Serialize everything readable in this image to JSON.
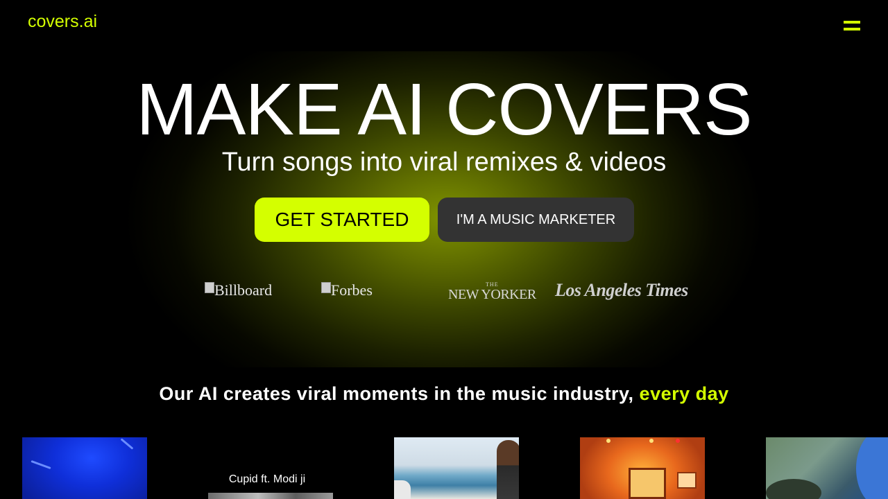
{
  "header": {
    "logo_text": "covers.ai",
    "menu_icon": "hamburger-menu-icon"
  },
  "hero": {
    "title": "MAKE AI COVERS",
    "subtitle": "Turn songs into viral remixes & videos",
    "primary_button": "GET STARTED",
    "secondary_button": "I'M A MUSIC MARKETER"
  },
  "press": {
    "logos": [
      {
        "alt_text": "Billboard",
        "broken_image": true
      },
      {
        "alt_text": "Forbes",
        "broken_image": true
      },
      {
        "the": "THE",
        "name": "NEW YORKER"
      },
      {
        "name": "Los Angeles Times"
      }
    ]
  },
  "tagline": {
    "main": "Our AI creates viral moments in the music industry, ",
    "highlight": "every day"
  },
  "video_grid": {
    "tiles": [
      {
        "caption": ""
      },
      {
        "caption": "Cupid ft. Modi ji"
      },
      {
        "caption": ""
      },
      {
        "caption": ""
      },
      {
        "caption": ""
      }
    ]
  },
  "colors": {
    "accent": "#d4ff00",
    "background": "#000000",
    "secondary_button": "#333333"
  }
}
